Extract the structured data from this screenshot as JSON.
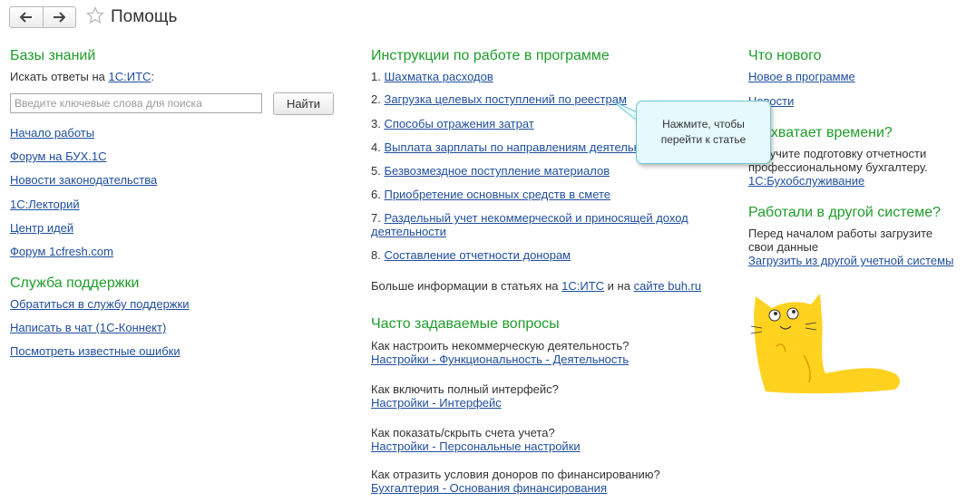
{
  "header": {
    "title": "Помощь",
    "back_icon": "arrow-left-icon",
    "forward_icon": "arrow-right-icon",
    "favorite_icon": "star-icon"
  },
  "colors": {
    "heading": "#1f9d2a",
    "link": "#1f4e9c",
    "tooltip_bg": "#e6f9fc",
    "tooltip_border": "#6cc6d4",
    "cat": "#ffd21f"
  },
  "knowledge": {
    "heading": "Базы знаний",
    "search_prompt": "Искать ответы на",
    "search_link": "1С:ИТС",
    "search_colon": ":",
    "search_placeholder": "Введите ключевые слова для поиска",
    "search_value": "",
    "find_button": "Найти",
    "links": [
      "Начало работы",
      "Форум на БУХ.1С",
      "Новости законодательства",
      "1С:Лекторий",
      "Центр идей",
      "Форум 1cfresh.com"
    ]
  },
  "support": {
    "heading": "Служба поддержки",
    "links": [
      "Обратиться в службу поддержки",
      "Написать в чат (1С-Коннект)",
      "Посмотреть известные ошибки"
    ]
  },
  "instructions": {
    "heading": "Инструкции по работе в программе",
    "items": [
      {
        "num": "1.",
        "text": "Шахматка расходов"
      },
      {
        "num": "2.",
        "text": "Загрузка целевых поступлений по реестрам"
      },
      {
        "num": "3.",
        "text": "Способы отражения затрат"
      },
      {
        "num": "4.",
        "text": "Выплата зарплаты по направлениям деятельности"
      },
      {
        "num": "5.",
        "text": "Безвозмездное поступление материалов"
      },
      {
        "num": "6.",
        "text": "Приобретение основных средств в смете"
      },
      {
        "num": "7.",
        "text": "Раздельный учет некоммерческой и приносящей доход",
        "text2": "деятельности"
      },
      {
        "num": "8.",
        "text": "Составление отчетности донорам"
      }
    ],
    "more_prefix": "Больше информации в статьях на",
    "more_link1": "1С:ИТС",
    "more_and": "и на",
    "more_link2": "сайте buh.ru"
  },
  "faq": {
    "heading": "Часто задаваемые вопросы",
    "items": [
      {
        "q": "Как настроить некоммерческую деятельность?",
        "a": "Настройки - Функциональность - Деятельность"
      },
      {
        "q": "Как включить полный интерфейс?",
        "a": "Настройки - Интерфейс"
      },
      {
        "q": "Как показать/скрыть счета учета?",
        "a": "Настройки - Персональные настройки"
      },
      {
        "q": "Как отразить условия доноров по финансированию?",
        "a": "Бухгалтерия - Основания финансирования"
      }
    ]
  },
  "whats_new": {
    "heading": "Что нового",
    "links": [
      "Новое в программе",
      "Новости"
    ]
  },
  "no_time": {
    "heading": "Не хватает времени?",
    "text1": "Поручите подготовку отчетности",
    "text2": "профессиональному бухгалтеру.",
    "link": "1С:Бухобслуживание"
  },
  "other_system": {
    "heading": "Работали в другой системе?",
    "text1": "Перед началом работы загрузите",
    "text2": "свои данные",
    "link": "Загрузить из другой учетной системы"
  },
  "tooltip": {
    "line1": "Нажмите, чтобы",
    "line2": "перейти к статье"
  }
}
